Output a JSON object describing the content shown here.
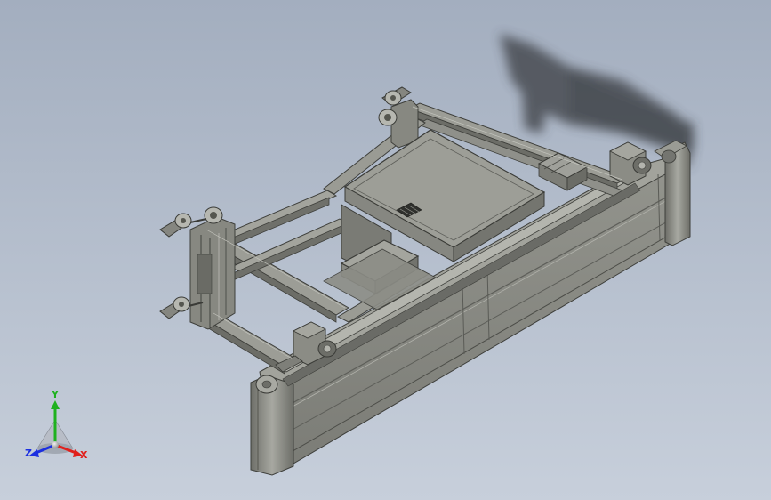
{
  "viewport": {
    "background_top": "#a3aebf",
    "background_bottom": "#c7cfdb"
  },
  "model": {
    "frame_color": "#8c8d86",
    "frame_dark": "#4e4f4a",
    "panel_color": "#8e8f88",
    "box_top_color": "#9d9e97",
    "shadow_color": "#3a3d42"
  },
  "triad": {
    "x_label": "X",
    "y_label": "Y",
    "z_label": "Z",
    "x_color": "#e0201c",
    "y_color": "#1fb11f",
    "z_color": "#1c2fe0"
  }
}
